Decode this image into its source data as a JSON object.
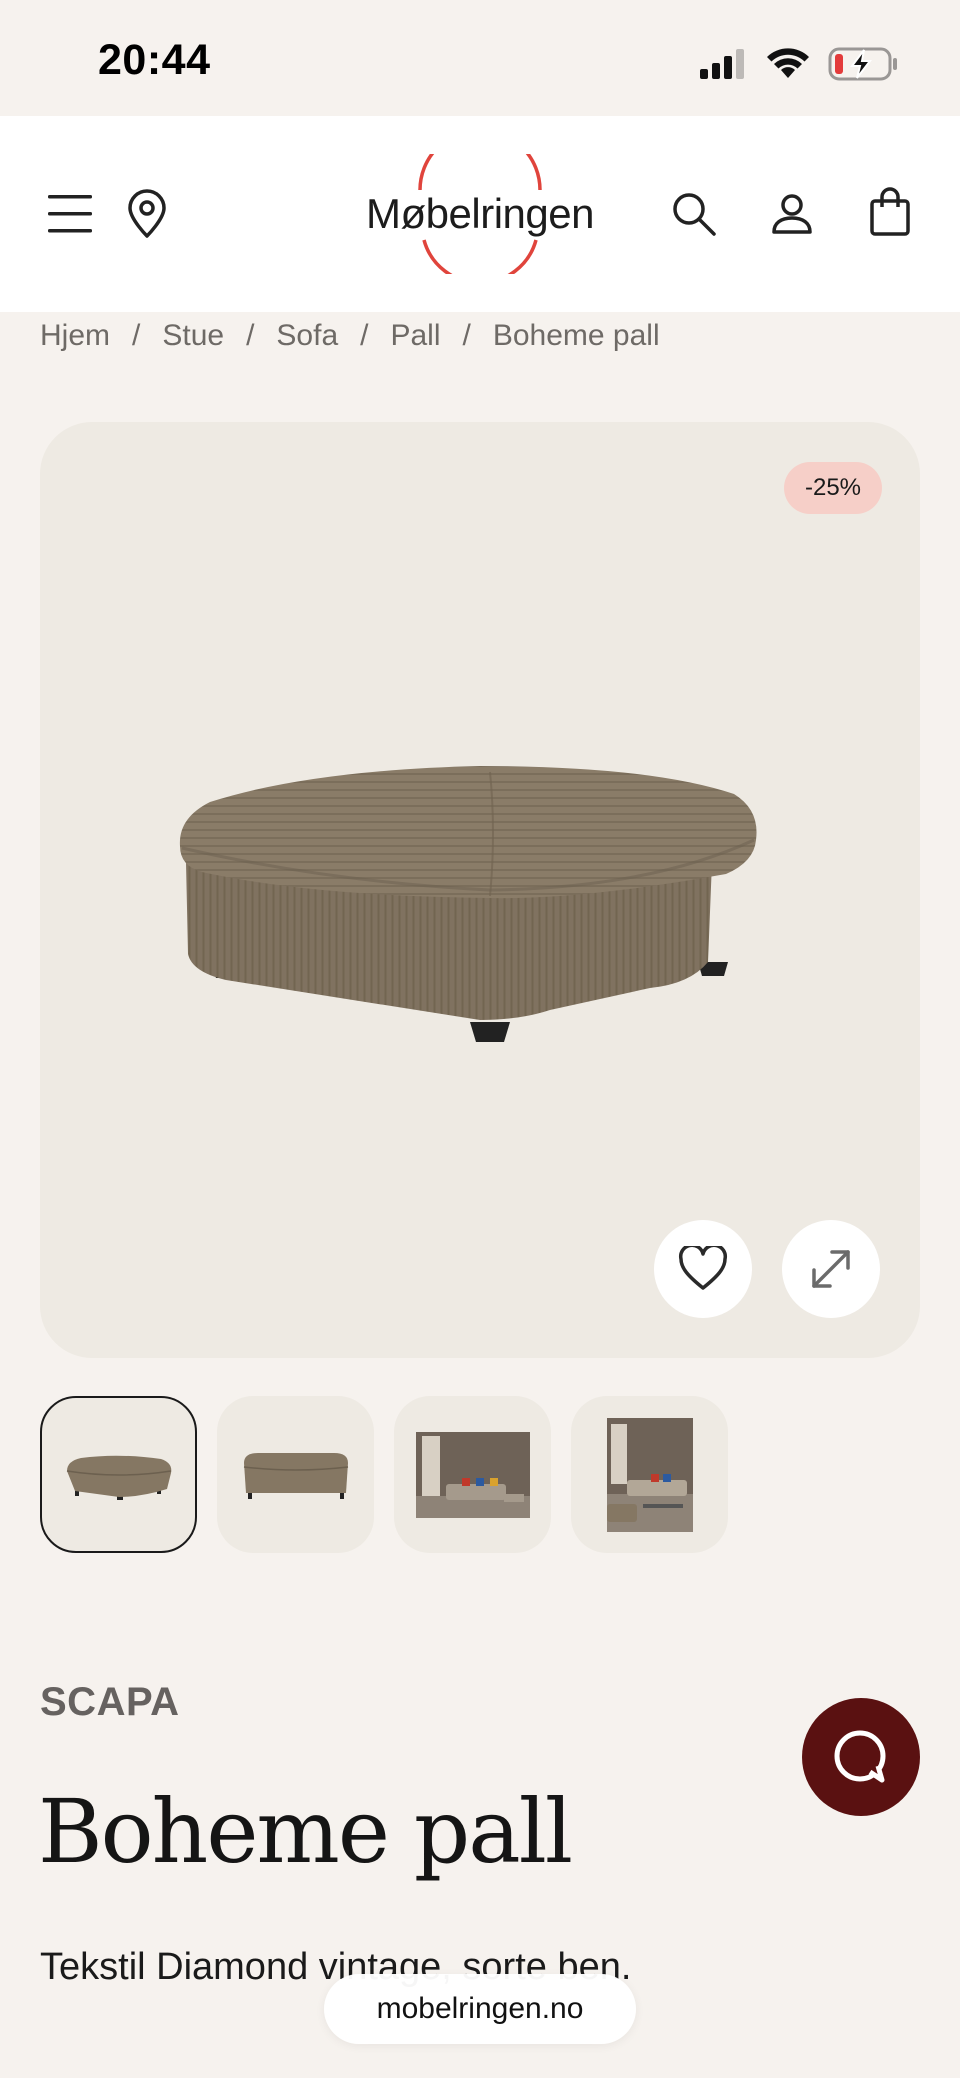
{
  "status_bar": {
    "time": "20:44",
    "icons": [
      "cellular-signal-icon",
      "wifi-icon",
      "battery-charging-icon"
    ]
  },
  "header": {
    "logo_text": "Møbelringen",
    "icons": [
      "menu-icon",
      "location-pin-icon",
      "search-icon",
      "user-icon",
      "shopping-bag-icon"
    ]
  },
  "breadcrumb": [
    "Hjem",
    "Stue",
    "Sofa",
    "Pall",
    "Boheme pall"
  ],
  "gallery": {
    "discount_badge": "-25%",
    "actions": [
      "heart-icon",
      "expand-icon"
    ],
    "thumbnail_count": 4,
    "active_thumbnail": 1
  },
  "product": {
    "brand": "SCAPA",
    "title": "Boheme pall",
    "description": "Tekstil Diamond vintage, sorte ben."
  },
  "browser": {
    "url": "mobelringen.no"
  },
  "colors": {
    "background": "#f6f2ee",
    "logo_ring": "#e0443c",
    "badge": "#f6cfc8",
    "chat_button": "#5a1111"
  }
}
